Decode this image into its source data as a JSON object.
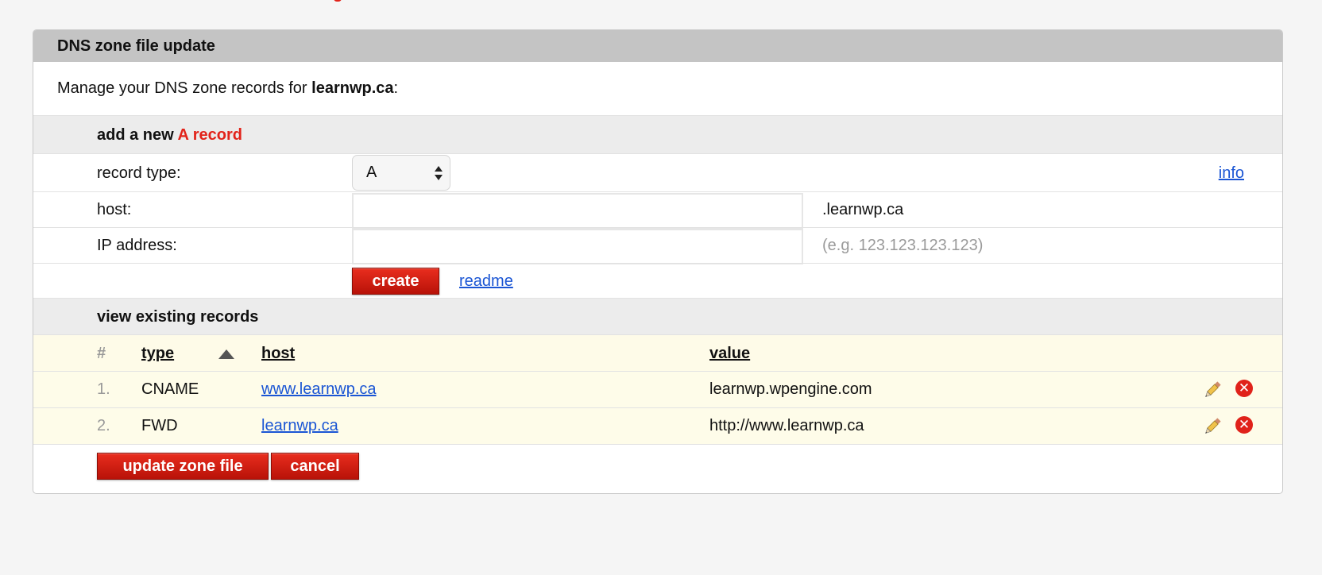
{
  "panel": {
    "title": "DNS zone file update",
    "intro_prefix": "Manage your DNS zone records for ",
    "domain": "learnwp.ca",
    "intro_suffix": ":"
  },
  "add_record": {
    "title_prefix": "add a new ",
    "title_type": "A record",
    "record_type_label": "record type:",
    "record_type_value": "A",
    "info_link": "info",
    "host_label": "host:",
    "host_value": "",
    "host_suffix": ".learnwp.ca",
    "ip_label": "IP address:",
    "ip_value": "",
    "ip_hint": "(e.g. 123.123.123.123)",
    "create_button": "create",
    "readme_link": "readme"
  },
  "existing": {
    "title": "view existing records",
    "columns": {
      "num": "#",
      "type": "type",
      "host": "host",
      "value": "value"
    },
    "sort_column": "type",
    "sort_direction": "ascending",
    "records": [
      {
        "num": "1.",
        "type": "CNAME",
        "host": "www.learnwp.ca",
        "value": "learnwp.wpengine.com"
      },
      {
        "num": "2.",
        "type": "FWD",
        "host": "learnwp.ca",
        "value": "http://www.learnwp.ca"
      }
    ]
  },
  "actions": {
    "update_button": "update zone file",
    "cancel_button": "cancel"
  },
  "colors": {
    "accent": "#e2231a",
    "link": "#1a55d4",
    "header_bg": "#c4c4c4",
    "section_bg": "#ececec",
    "table_bg": "#fefce9"
  },
  "icons": {
    "edit": "pencil-icon",
    "delete": "delete-x-icon",
    "sort": "sort-up-arrow-icon"
  }
}
